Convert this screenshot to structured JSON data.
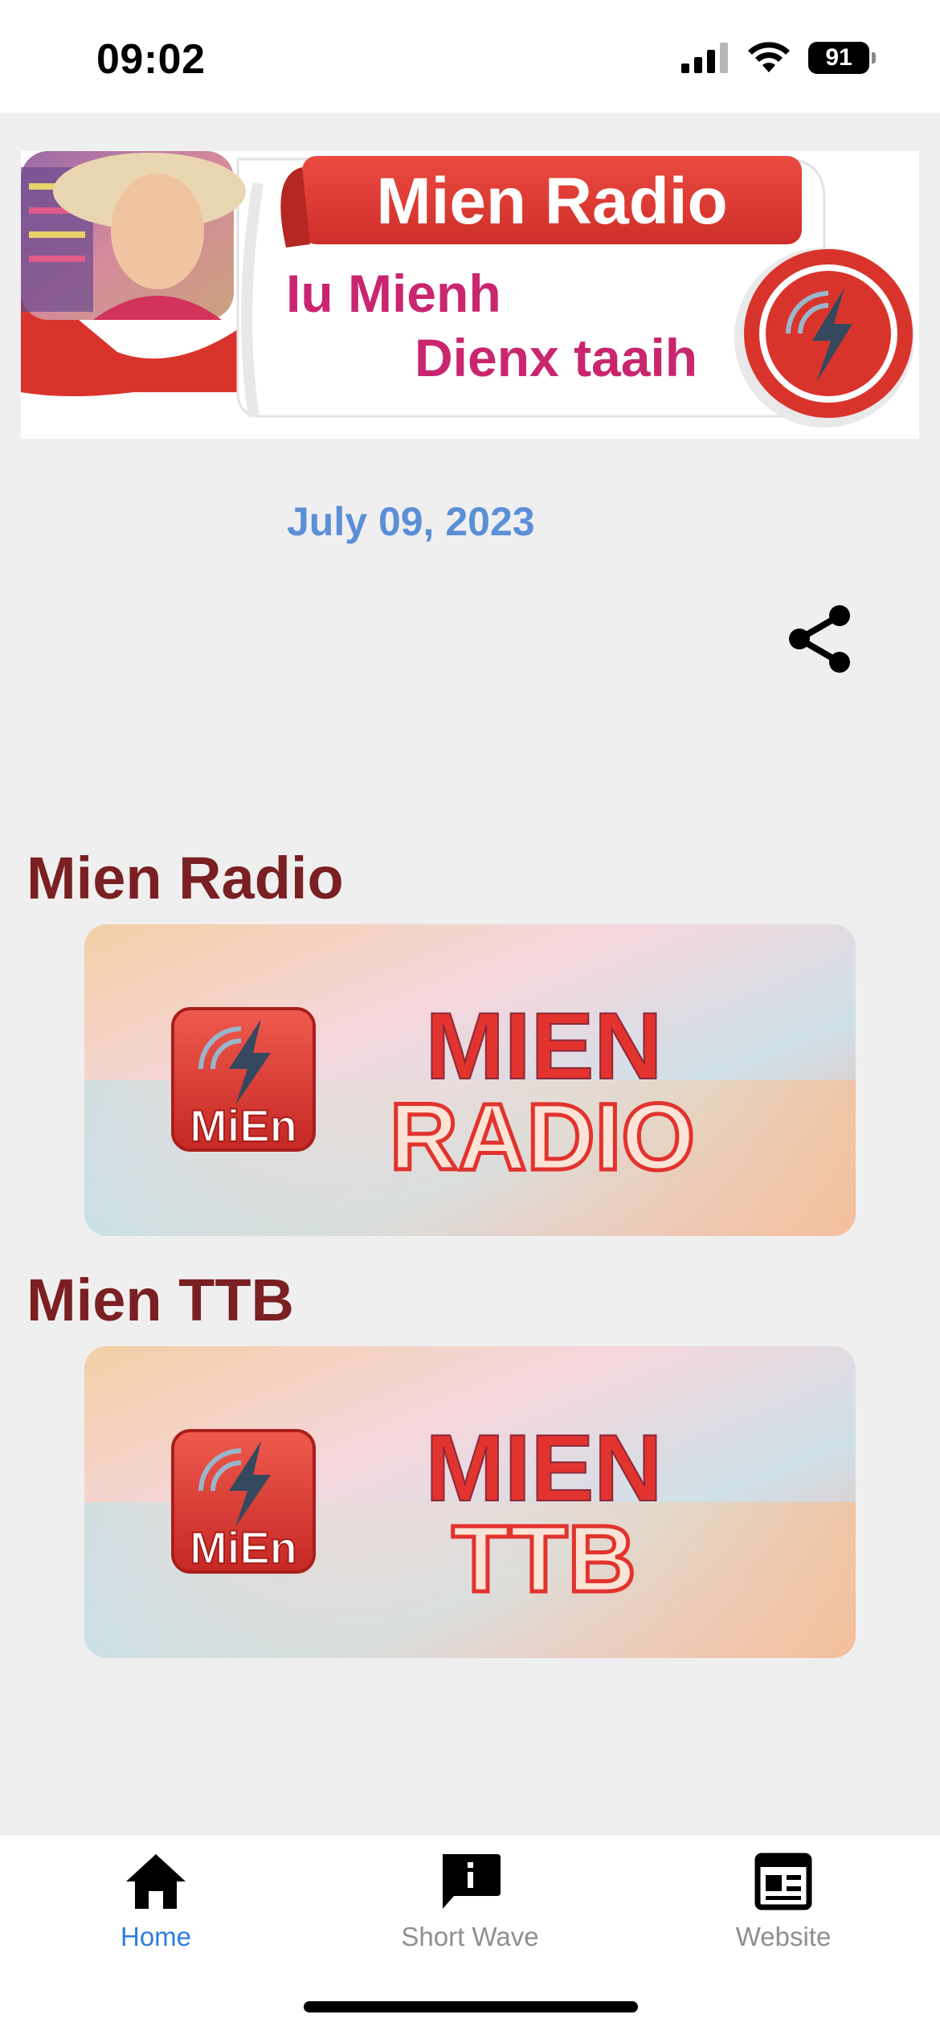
{
  "status_bar": {
    "time": "09:02",
    "battery": "91",
    "icons": [
      "signal-icon",
      "wifi-icon",
      "battery-icon"
    ]
  },
  "banner": {
    "title": "Mien Radio",
    "line1": "Iu Mienh",
    "line2": "Dienx taaih"
  },
  "date": "July 09, 2023",
  "share_icon": "share-icon",
  "stations": [
    {
      "title": "Mien Radio",
      "badge": "MiEn",
      "line1": "MIEN",
      "line2": "RADIO"
    },
    {
      "title": "Mien TTB",
      "badge": "MiEn",
      "line1": "MIEN",
      "line2": "TTB"
    }
  ],
  "tabs": [
    {
      "label": "Home",
      "icon": "home-icon",
      "active": true
    },
    {
      "label": "Short Wave",
      "icon": "info-message-icon",
      "active": false
    },
    {
      "label": "Website",
      "icon": "newspaper-icon",
      "active": false
    }
  ],
  "colors": {
    "accent": "#2f7ee0",
    "date": "#5b8fd6",
    "section_title": "#7a1f22",
    "brand_red": "#e2332e",
    "banner_pink": "#c9266f"
  }
}
